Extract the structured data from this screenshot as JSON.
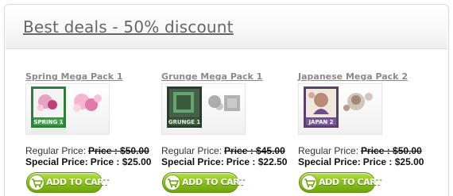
{
  "panel": {
    "title": "Best deals - 50% discount"
  },
  "products": [
    {
      "name": "Spring Mega Pack 1",
      "image_icon": "product-box-spring-icon",
      "image_text": "SPRING 1",
      "regular_label": "Regular Price:",
      "regular_price": "Price : $50.00",
      "special_label": "Special Price:",
      "special_price": "Price : $25.00",
      "cart_label": "ADD TO CART"
    },
    {
      "name": "Grunge Mega Pack 1",
      "image_icon": "product-box-grunge-icon",
      "image_text": "GRUNGE 1",
      "regular_label": "Regular Price:",
      "regular_price": "Price : $45.00",
      "special_label": "Special Price:",
      "special_price": "Price : $22.50",
      "cart_label": "ADD TO CART"
    },
    {
      "name": "Japanese Mega Pack 2",
      "image_icon": "product-box-japanese-icon",
      "image_text": "JAPAN 2",
      "regular_label": "Regular Price:",
      "regular_price": "Price : $50.00",
      "special_label": "Special Price:",
      "special_price": "Price : $25.00",
      "cart_label": "ADD TO CART"
    }
  ],
  "colors": {
    "button_green": "#8cc21c",
    "title_gray": "#666666",
    "link_gray": "#8a8a8a"
  }
}
